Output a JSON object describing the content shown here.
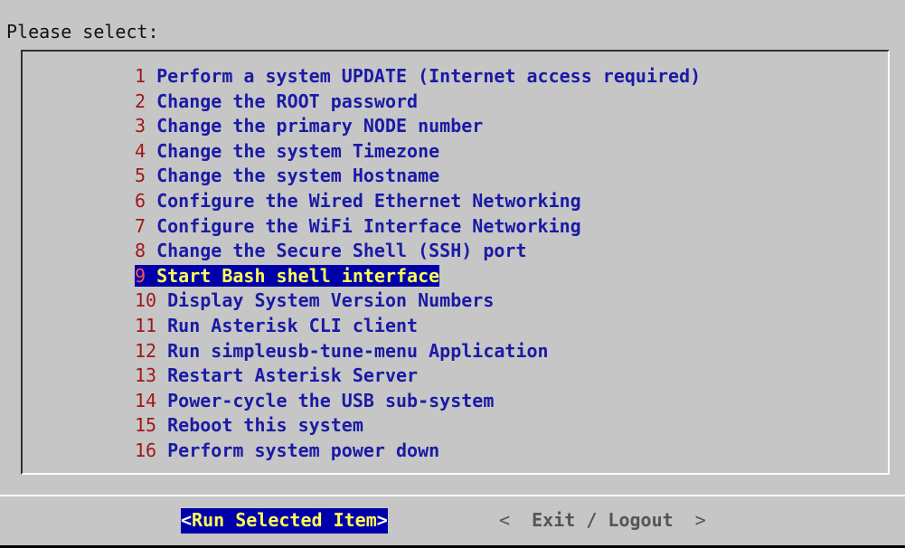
{
  "prompt": "Please select:",
  "menu": {
    "selected_tag": "9",
    "items": [
      {
        "tag": "1",
        "label": "Perform a system UPDATE (Internet access required)"
      },
      {
        "tag": "2",
        "label": "Change the ROOT password"
      },
      {
        "tag": "3",
        "label": "Change the primary NODE number"
      },
      {
        "tag": "4",
        "label": "Change the system Timezone"
      },
      {
        "tag": "5",
        "label": "Change the system Hostname"
      },
      {
        "tag": "6",
        "label": "Configure the Wired Ethernet Networking"
      },
      {
        "tag": "7",
        "label": "Configure the WiFi Interface Networking"
      },
      {
        "tag": "8",
        "label": "Change the Secure Shell (SSH) port"
      },
      {
        "tag": "9",
        "label": "Start Bash shell interface"
      },
      {
        "tag": "10",
        "label": "Display System Version Numbers"
      },
      {
        "tag": "11",
        "label": "Run Asterisk CLI client"
      },
      {
        "tag": "12",
        "label": "Run simpleusb-tune-menu Application"
      },
      {
        "tag": "13",
        "label": "Restart Asterisk Server"
      },
      {
        "tag": "14",
        "label": "Power-cycle the USB sub-system"
      },
      {
        "tag": "15",
        "label": "Reboot this system"
      },
      {
        "tag": "16",
        "label": "Perform system power down"
      }
    ]
  },
  "buttons": {
    "run": {
      "open": "<",
      "label": "Run Selected Item",
      "close": ">"
    },
    "exit": {
      "open": "<",
      "label": "Exit / Logout",
      "close": ">"
    }
  },
  "colors": {
    "background": "#c6c6c6",
    "item_text": "#1a1aa6",
    "item_tag": "#a01818",
    "highlight_bg": "#0000aa",
    "highlight_text": "#ffff55"
  }
}
